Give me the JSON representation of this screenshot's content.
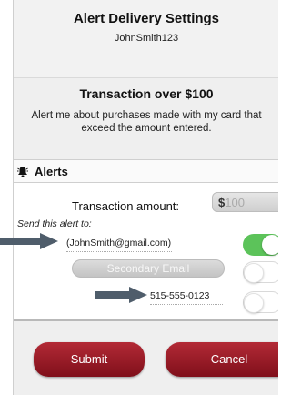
{
  "header": {
    "title": "Alert Delivery Settings",
    "username": "JohnSmith123"
  },
  "transaction": {
    "heading": "Transaction over $100",
    "description_line1": "Alert me about purchases made with my card that",
    "description_line2": "exceed the amount entered."
  },
  "alerts": {
    "label": "Alerts",
    "amount_label": "Transaction amount:",
    "amount_currency": "$",
    "amount_placeholder": "100",
    "send_to_label": "Send this alert to:",
    "email": "(JohnSmith@gmail.com)",
    "email_toggle_on": true,
    "secondary_email_label": "Secondary Email",
    "secondary_toggle_on": false,
    "phone": "515-555-0123",
    "phone_toggle_on": false
  },
  "actions": {
    "submit_label": "Submit",
    "cancel_label": "Cancel"
  },
  "colors": {
    "accent_red": "#9a1c28",
    "toggle_green": "#5cc35a",
    "arrow_gray": "#4f5d6b"
  }
}
